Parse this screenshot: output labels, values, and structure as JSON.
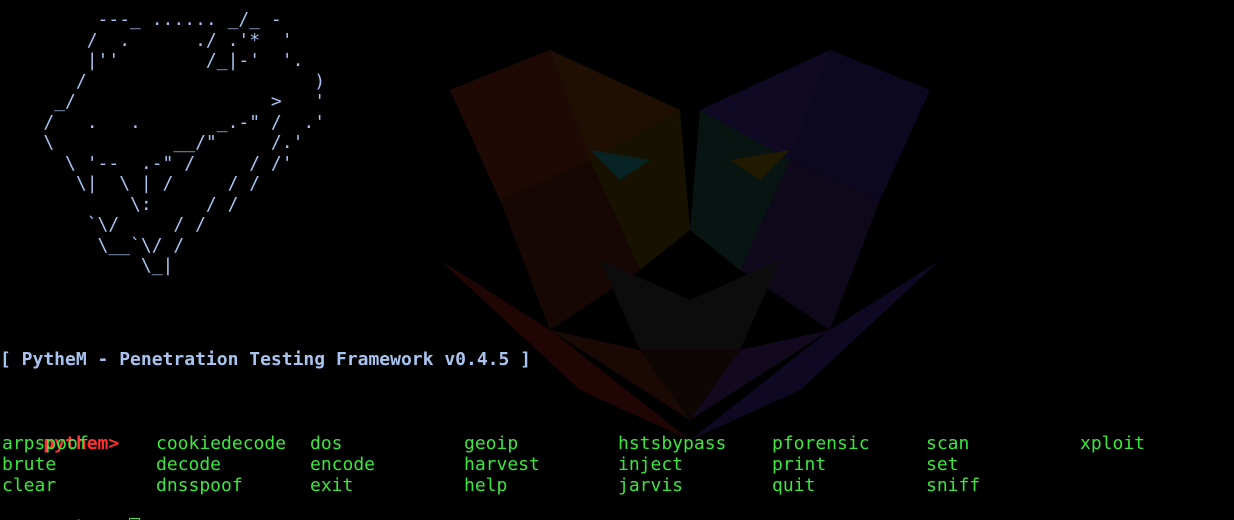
{
  "colors": {
    "background": "#000000",
    "art": "#a8c4ee",
    "title": "#a8c4ee",
    "prompt": "#ff3030",
    "cmd": "#3ce63c",
    "cursor": "#3ce63c"
  },
  "wallpaper_icon": "wolf-logo-icon",
  "banner_art": "         ---_ ...... _/_ -\n        /  .      ./ .'*  '\n        |''        /_|-'  '.\n       /                     )\n     _/                  >   '\n    /   .   .       _.-\" /  .'\n    \\           __/\"     /.'\n      \\ '--  .-\" /     / /'\n       \\|  \\ | /     / /\n            \\:     / /\n        `\\/     / /\n         \\__`\\/ /\n             \\_|",
  "framework_title": "[ PytheM - Penetration Testing Framework v0.4.5 ]",
  "prompt": "pythem>",
  "help_commands": [
    [
      "arpspoof",
      "cookiedecode",
      "dos",
      "geoip",
      "hstsbypass",
      "pforensic",
      "scan",
      "xploit"
    ],
    [
      "brute",
      "decode",
      "encode",
      "harvest",
      "inject",
      "print",
      "set"
    ],
    [
      "clear",
      "dnsspoof",
      "exit",
      "help",
      "jarvis",
      "quit",
      "sniff"
    ]
  ]
}
